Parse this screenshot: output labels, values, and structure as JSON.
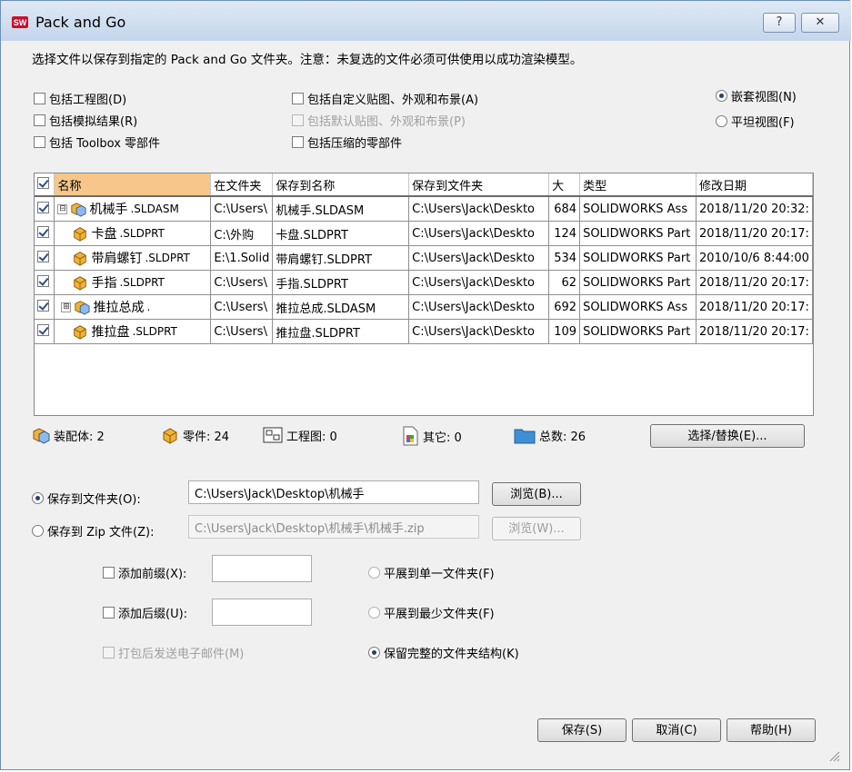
{
  "window": {
    "title": "Pack and Go",
    "help_label": "?",
    "close_label": "✕"
  },
  "intro": "选择文件以保存到指定的 Pack and Go 文件夹。注意：未复选的文件必须可供使用以成功渲染模型。",
  "options": {
    "include_drawings": "包括工程图(D)",
    "include_sim": "包括模拟结果(R)",
    "include_toolbox": "包括 Toolbox 零部件",
    "include_custom_decals": "包括自定义贴图、外观和布景(A)",
    "include_default_decals": "包括默认贴图、外观和布景(P)",
    "include_suppressed": "包括压缩的零部件",
    "nested_view": "嵌套视图(N)",
    "flat_view": "平坦视图(F)"
  },
  "table": {
    "headers": [
      "名称",
      "在文件夹",
      "保存到名称",
      "保存到文件夹",
      "大",
      "类型",
      "修改日期"
    ],
    "rows": [
      {
        "name": "机械手",
        "ext": ".SLDASM",
        "in_folder": "C:\\Users\\",
        "save_name": "机械手.SLDASM",
        "save_folder": "C:\\Users\\Jack\\Deskto",
        "size": "684",
        "type": "SOLIDWORKS Ass",
        "date": "2018/11/20 20:32:",
        "expander": "⊟",
        "icon": "assembly-icon"
      },
      {
        "name": "卡盘",
        "ext": ".SLDPRT",
        "in_folder": "C:\\外购",
        "save_name": "卡盘.SLDPRT",
        "save_folder": "C:\\Users\\Jack\\Deskto",
        "size": "124",
        "type": "SOLIDWORKS Part",
        "date": "2018/11/20 20:17:",
        "expander": "",
        "icon": "part-icon"
      },
      {
        "name": "带肩螺钉",
        "ext": ".SLDPRT",
        "in_folder": "E:\\1.Solid",
        "save_name": "带肩螺钉.SLDPRT",
        "save_folder": "C:\\Users\\Jack\\Deskto",
        "size": "534",
        "type": "SOLIDWORKS Part",
        "date": "2010/10/6 8:44:00",
        "expander": "",
        "icon": "part-icon"
      },
      {
        "name": "手指",
        "ext": ".SLDPRT",
        "in_folder": "C:\\Users\\",
        "save_name": "手指.SLDPRT",
        "save_folder": "C:\\Users\\Jack\\Deskto",
        "size": "62",
        "type": "SOLIDWORKS Part",
        "date": "2018/11/20 20:17:",
        "expander": "",
        "icon": "part-icon"
      },
      {
        "name": "推拉总成",
        "ext": ".",
        "in_folder": "C:\\Users\\",
        "save_name": "推拉总成.SLDASM",
        "save_folder": "C:\\Users\\Jack\\Deskto",
        "size": "692",
        "type": "SOLIDWORKS Ass",
        "date": "2018/11/20 20:17:",
        "expander": "⊞",
        "icon": "assembly-icon"
      },
      {
        "name": "推拉盘",
        "ext": ".SLDPRT",
        "in_folder": "C:\\Users\\",
        "save_name": "推拉盘.SLDPRT",
        "save_folder": "C:\\Users\\Jack\\Deskto",
        "size": "109",
        "type": "SOLIDWORKS Part",
        "date": "2018/11/20 20:17:",
        "expander": "",
        "icon": "part-icon"
      }
    ]
  },
  "summary": {
    "assemblies": "装配体: 2",
    "parts": "零件: 24",
    "drawings": "工程图: 0",
    "others": "其它: 0",
    "total": "总数: 26",
    "select_replace": "选择/替换(E)..."
  },
  "save": {
    "to_folder_label": "保存到文件夹(O):",
    "folder_path": "C:\\Users\\Jack\\Desktop\\机械手",
    "browse": "浏览(B)...",
    "to_zip_label": "保存到 Zip 文件(Z):",
    "zip_path": "C:\\Users\\Jack\\Desktop\\机械手\\机械手.zip",
    "browse_zip": "浏览(W)...",
    "add_prefix": "添加前缀(X):",
    "add_suffix": "添加后缀(U):",
    "email": "打包后发送电子邮件(M)",
    "flatten_single": "平展到单一文件夹(F)",
    "flatten_min": "平展到最少文件夹(F)",
    "keep_structure": "保留完整的文件夹结构(K)"
  },
  "buttons": {
    "save": "保存(S)",
    "cancel": "取消(C)",
    "help": "帮助(H)"
  },
  "colors": {
    "selected_header": "#f6c68a",
    "title_gradient_top": "#dfe9f5",
    "title_gradient_bottom": "#c4d6ec",
    "part_icon": "#f0b23a",
    "assembly_icon": "#f0b23a"
  }
}
